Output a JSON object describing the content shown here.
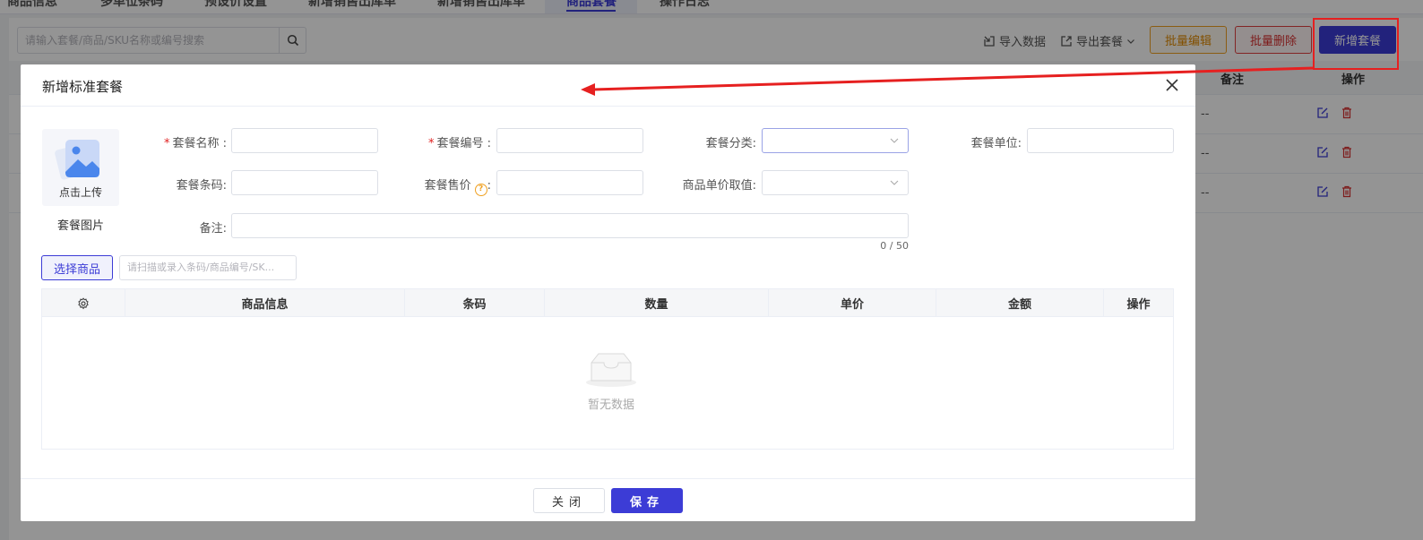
{
  "tabs": [
    {
      "label": "商品信息",
      "active": false
    },
    {
      "label": "多单位条码",
      "active": false
    },
    {
      "label": "预设价设置",
      "active": false
    },
    {
      "label": "新增销售出库单",
      "active": false
    },
    {
      "label": "新增销售出库单",
      "active": false
    },
    {
      "label": "商品套餐",
      "active": true
    },
    {
      "label": "操作日志",
      "active": false
    }
  ],
  "toolbar": {
    "search_placeholder": "请输入套餐/商品/SKU名称或编号搜索",
    "import_label": "导入数据",
    "export_label": "导出套餐",
    "batch_edit_label": "批量编辑",
    "batch_delete_label": "批量删除",
    "add_package_label": "新增套餐"
  },
  "bg_table": {
    "columns": [
      "备注",
      "操作"
    ],
    "rows": [
      {
        "remark": "--"
      },
      {
        "remark": "--"
      },
      {
        "remark": "--"
      }
    ]
  },
  "modal": {
    "title": "新增标准套餐",
    "upload_text": "点击上传",
    "image_label": "套餐图片",
    "fields": {
      "name": {
        "label": "套餐名称",
        "required": true,
        "value": ""
      },
      "code": {
        "label": "套餐编号",
        "required": true,
        "value": ""
      },
      "category": {
        "label": "套餐分类",
        "value": ""
      },
      "unit": {
        "label": "套餐单位",
        "value": ""
      },
      "barcode": {
        "label": "套餐条码",
        "value": ""
      },
      "price": {
        "label": "套餐售价",
        "value": ""
      },
      "unit_price_source": {
        "label": "商品单价取值",
        "value": ""
      },
      "remark": {
        "label": "备注",
        "value": "",
        "counter": "0 / 50"
      }
    },
    "select_goods_label": "选择商品",
    "scan_placeholder": "请扫描或录入条码/商品编号/SK...",
    "goods_table": {
      "columns": [
        "商品信息",
        "条码",
        "数量",
        "单价",
        "金额",
        "操作"
      ],
      "empty_text": "暂无数据"
    },
    "close_label": "关闭",
    "save_label": "保存"
  },
  "colors": {
    "primary": "#3c3cd6",
    "warning": "#f0a020",
    "danger": "#e04040",
    "annotation": "#e62020"
  }
}
